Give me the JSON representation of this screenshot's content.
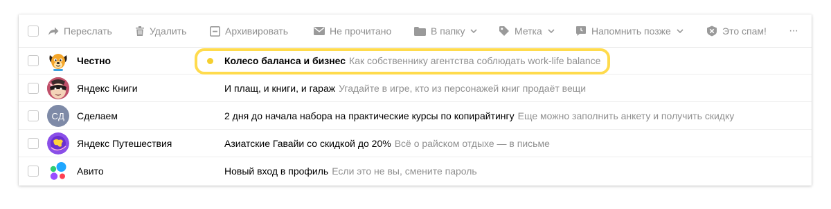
{
  "toolbar": {
    "forward": "Переслать",
    "delete": "Удалить",
    "archive": "Архивировать",
    "unread": "Не прочитано",
    "to_folder": "В папку",
    "label": "Метка",
    "remind": "Напомнить позже",
    "spam": "Это спам!",
    "more": "···"
  },
  "messages": [
    {
      "sender": "Честно",
      "subject": "Колесо баланса и бизнес",
      "preview": "Как собственнику агентства соблюдать work-life balance",
      "unread": true,
      "avatar": "dog-avatar"
    },
    {
      "sender": "Яндекс Книги",
      "subject": "И плащ, и книги, и гараж",
      "preview": "Угадайте в игре, кто из персонажей книг продаёт вещи",
      "unread": false,
      "avatar": "masked-face-avatar"
    },
    {
      "sender": "Сделаем",
      "subject": "2 дня до начала набора на практические курсы по копирайтингу",
      "preview": "Еще можно заполнить анкету и получить скидку",
      "unread": false,
      "avatar": "СД"
    },
    {
      "sender": "Яндекс Путешествия",
      "subject": "Азиатские Гавайи со скидкой до 20%",
      "preview": "Всё о райском отдыхе — в письме",
      "unread": false,
      "avatar": "globe-avatar"
    },
    {
      "sender": "Авито",
      "subject": "Новый вход в профиль",
      "preview": "Если это не вы, смените пароль",
      "unread": false,
      "avatar": "avito-dots-avatar"
    }
  ],
  "colors": {
    "highlight": "#ffdb4d",
    "unread_dot": "#f5cf2f",
    "muted_text": "#8f8f8f"
  }
}
